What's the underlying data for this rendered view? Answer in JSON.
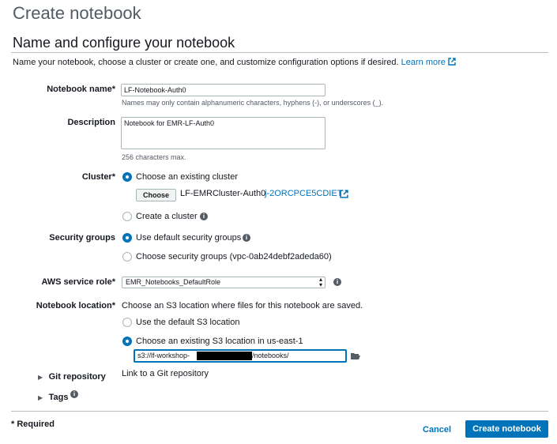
{
  "page": {
    "title": "Create notebook",
    "section_title": "Name and configure your notebook",
    "intro": "Name your notebook, choose a cluster or create one, and customize configuration options if desired.",
    "learn_more": "Learn more"
  },
  "form": {
    "notebook_name": {
      "label": "Notebook name*",
      "value": "LF-Notebook-Auth0",
      "hint": "Names may only contain alphanumeric characters, hyphens (-), or underscores (_)."
    },
    "description": {
      "label": "Description",
      "value": "Notebook for EMR-LF-Auth0",
      "hint": "256 characters max."
    },
    "cluster": {
      "label": "Cluster*",
      "option_existing": "Choose an existing cluster",
      "choose_button": "Choose",
      "cluster_name": "LF-EMRCluster-Auth0",
      "cluster_id": "j-2ORCPCE5CDIET",
      "option_create": "Create a cluster"
    },
    "security_groups": {
      "label": "Security groups",
      "option_default": "Use default security groups",
      "option_choose": "Choose security groups (vpc-0ab24debf2adeda60)"
    },
    "service_role": {
      "label": "AWS service role*",
      "value": "EMR_Notebooks_DefaultRole"
    },
    "location": {
      "label": "Notebook location*",
      "description": "Choose an S3 location where files for this notebook are saved.",
      "option_default": "Use the default S3 location",
      "option_existing": "Choose an existing S3 location in us-east-1",
      "path_prefix": "s3://lf-workshop-",
      "path_suffix": "/notebooks/"
    },
    "git": {
      "label": "Git repository",
      "link": "Link to a Git repository"
    },
    "tags": {
      "label": "Tags"
    }
  },
  "footer": {
    "required_note": "* Required",
    "cancel": "Cancel",
    "submit": "Create notebook"
  },
  "colors": {
    "accent": "#0073bb",
    "text": "#16191f",
    "muted": "#545b64"
  }
}
